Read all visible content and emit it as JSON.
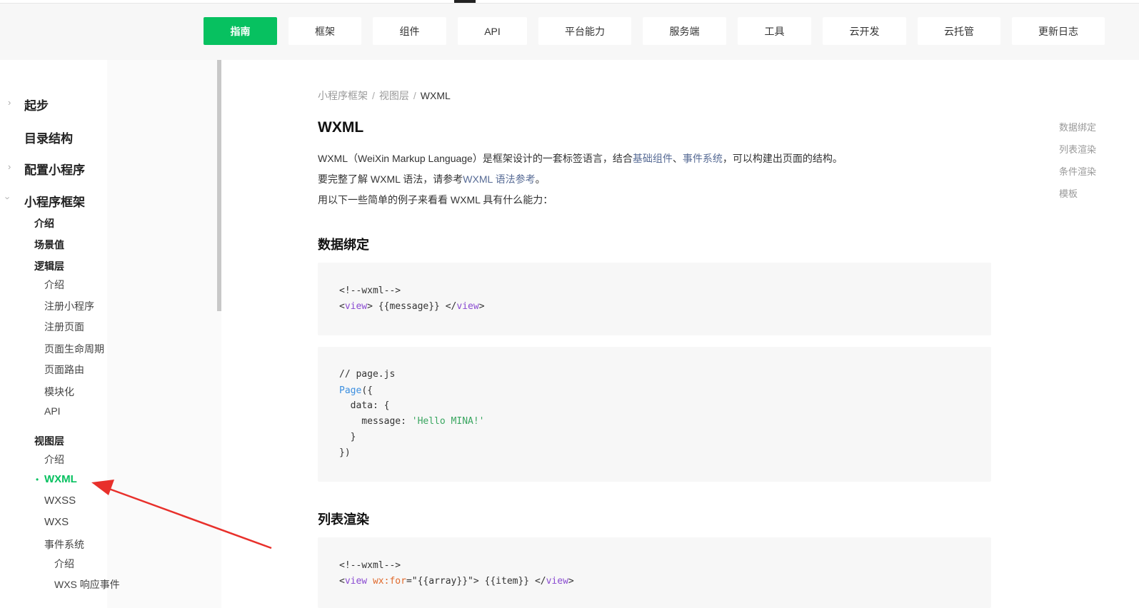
{
  "topnav": {
    "items": [
      "指南",
      "框架",
      "组件",
      "API",
      "平台能力",
      "服务端",
      "工具",
      "云开发",
      "云托管",
      "更新日志"
    ],
    "active_color": "#07c160"
  },
  "sidebar": {
    "qibu": "起步",
    "mulu": "目录结构",
    "peizhi": "配置小程序",
    "kuangjia": "小程序框架",
    "jieshao": "介绍",
    "changjingzhi": "场景值",
    "luojiceng": "逻辑层",
    "logic_children": [
      "介绍",
      "注册小程序",
      "注册页面",
      "页面生命周期",
      "页面路由",
      "模块化",
      "API"
    ],
    "shituceng": "视图层",
    "view_jieshao": "介绍",
    "wxml": "WXML",
    "wxss": "WXSS",
    "wxs": "WXS",
    "shijianxitong": "事件系统",
    "event_jieshao": "介绍",
    "wxs_event": "WXS 响应事件"
  },
  "breadcrumb": {
    "part1": "小程序框架",
    "part2": "视图层",
    "current": "WXML",
    "sep": "/"
  },
  "main": {
    "title": "WXML",
    "p1_pre": "WXML（WeiXin Markup Language）是框架设计的一套标签语言，结合",
    "p1_link1": "基础组件",
    "p1_mid": "、",
    "p1_link2": "事件系统",
    "p1_post": "，可以构建出页面的结构。",
    "p2_pre": "要完整了解 WXML 语法，请参考",
    "p2_link": "WXML 语法参考",
    "p2_post": "。",
    "p3": "用以下一些简单的例子来看看 WXML 具有什么能力：",
    "h_data_binding": "数据绑定",
    "h_list_render": "列表渲染"
  },
  "code": {
    "c1_comment": "<!--wxml-->",
    "c1_lt": "<",
    "c1_tag": "view",
    "c1_mid": "> {{message}} </",
    "c1_tag2": "view",
    "c1_gt": ">",
    "c2_comment": "// page.js",
    "c2_fn": "Page",
    "c2_open": "({",
    "c2_data": "  data: {",
    "c2_msg_key": "    message: ",
    "c2_msg_val": "'Hello MINA!'",
    "c2_close1": "  }",
    "c2_close2": "})",
    "c3_comment": "<!--wxml-->",
    "c3_lt": "<",
    "c3_tag": "view",
    "c3_attr": "wx:for",
    "c3_eq": "=\"{{array}}\"> {{item}} </",
    "c3_tag2": "view",
    "c3_gt": ">"
  },
  "toc": [
    "数据绑定",
    "列表渲染",
    "条件渲染",
    "模板"
  ],
  "colors": {
    "accent": "#07c160",
    "link": "#576b95",
    "arrow": "#e8302b"
  }
}
